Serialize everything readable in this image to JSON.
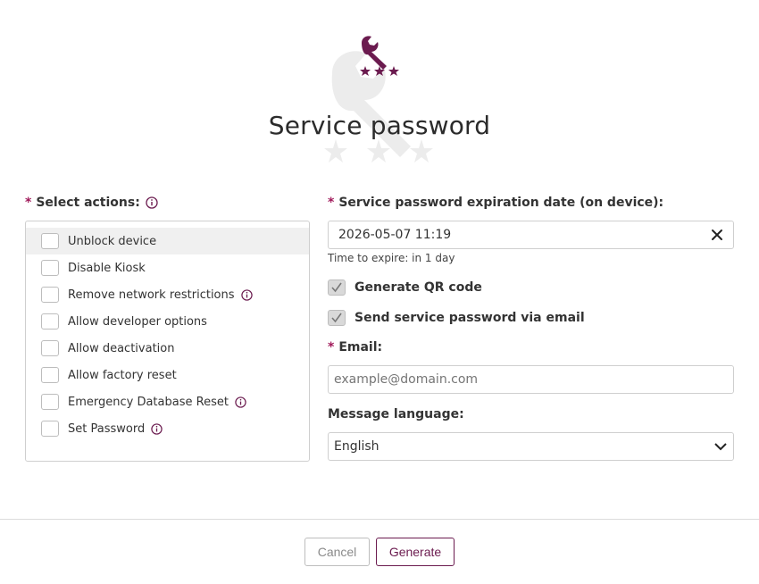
{
  "dialog": {
    "title": "Service password"
  },
  "actions": {
    "label": "Select actions:",
    "required_mark": "*",
    "items": [
      {
        "label": "Unblock device",
        "has_info": false
      },
      {
        "label": "Disable Kiosk",
        "has_info": false
      },
      {
        "label": "Remove network restrictions",
        "has_info": true
      },
      {
        "label": "Allow developer options",
        "has_info": false
      },
      {
        "label": "Allow deactivation",
        "has_info": false
      },
      {
        "label": "Allow factory reset",
        "has_info": false
      },
      {
        "label": "Emergency Database Reset",
        "has_info": true
      },
      {
        "label": "Set Password",
        "has_info": true
      }
    ]
  },
  "expiration": {
    "label": "Service password expiration date (on device):",
    "required_mark": "*",
    "value": "2026-05-07 11:19",
    "hint": "Time to expire: in 1 day"
  },
  "options": {
    "qr_label": "Generate QR code",
    "qr_checked": true,
    "email_label": "Send service password via email",
    "email_checked": true
  },
  "email": {
    "label": "Email:",
    "required_mark": "*",
    "placeholder": "example@domain.com"
  },
  "language": {
    "label": "Message language:",
    "selected": "English"
  },
  "footer": {
    "cancel_label": "Cancel",
    "generate_label": "Generate"
  },
  "colors": {
    "brand": "#6b1b4f",
    "required": "#a0195a",
    "watermark": "#e8e8e8"
  },
  "icons": {
    "header": "wrench-password-icon",
    "info": "info-circle-icon",
    "clear": "close-icon",
    "dropdown": "chevron-down-icon",
    "check": "checkmark-icon"
  }
}
